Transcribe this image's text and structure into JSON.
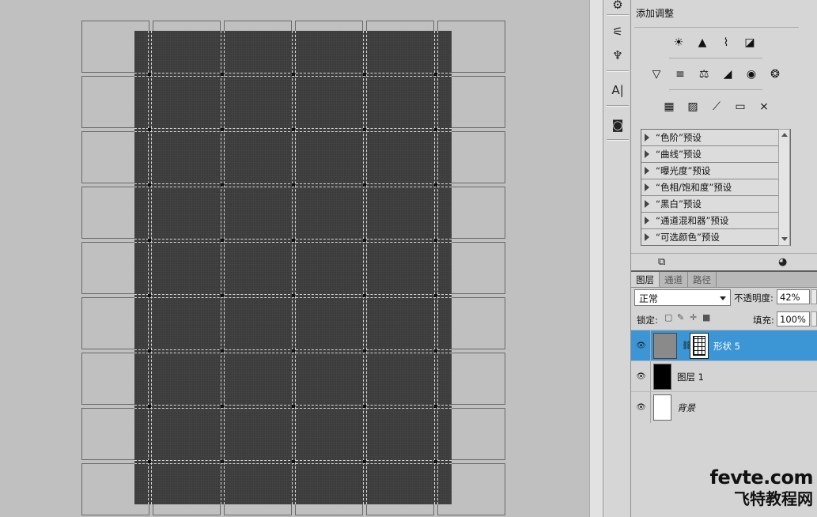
{
  "tools": {
    "items": [
      {
        "name": "adjust-tool",
        "glyph": "⚙"
      },
      {
        "name": "sliders-tool",
        "glyph": "⚟"
      },
      {
        "name": "usb-tool",
        "glyph": "♆"
      },
      {
        "name": "character-tool",
        "glyph": "A|"
      },
      {
        "name": "camera-tool",
        "glyph": "◙"
      }
    ]
  },
  "adjustments": {
    "title": "添加调整",
    "row1": [
      "☀",
      "▲",
      "⌇",
      "◪"
    ],
    "row2": [
      "▽",
      "≡",
      "⚖",
      "◢",
      "◉",
      "❂"
    ],
    "row3": [
      "▦",
      "▨",
      "⟋",
      "▭",
      "⨯"
    ],
    "presets": [
      "“色阶”预设",
      "“曲线”预设",
      "“曝光度”预设",
      "“色相/饱和度”预设",
      "“黑白”预设",
      "“通道混和器”预设",
      "“可选颜色”预设"
    ]
  },
  "layers": {
    "tabs": [
      "图层",
      "通道",
      "路径"
    ],
    "blend_mode": "正常",
    "opacity_label": "不透明度:",
    "opacity_value": "42%",
    "lock_label": "锁定:",
    "fill_label": "填充:",
    "fill_value": "100%",
    "rows": [
      {
        "name": "形状 5",
        "selected": true
      },
      {
        "name": "图层 1",
        "selected": false
      },
      {
        "name": "背景",
        "selected": false
      }
    ]
  },
  "watermark": {
    "line1": "fevte.com",
    "line2": "飞特教程网"
  },
  "colors": {
    "selection_blue": "#3c96d6",
    "shape_fill": "#3c3c3c",
    "canvas_bg": "#c0c0c0"
  }
}
